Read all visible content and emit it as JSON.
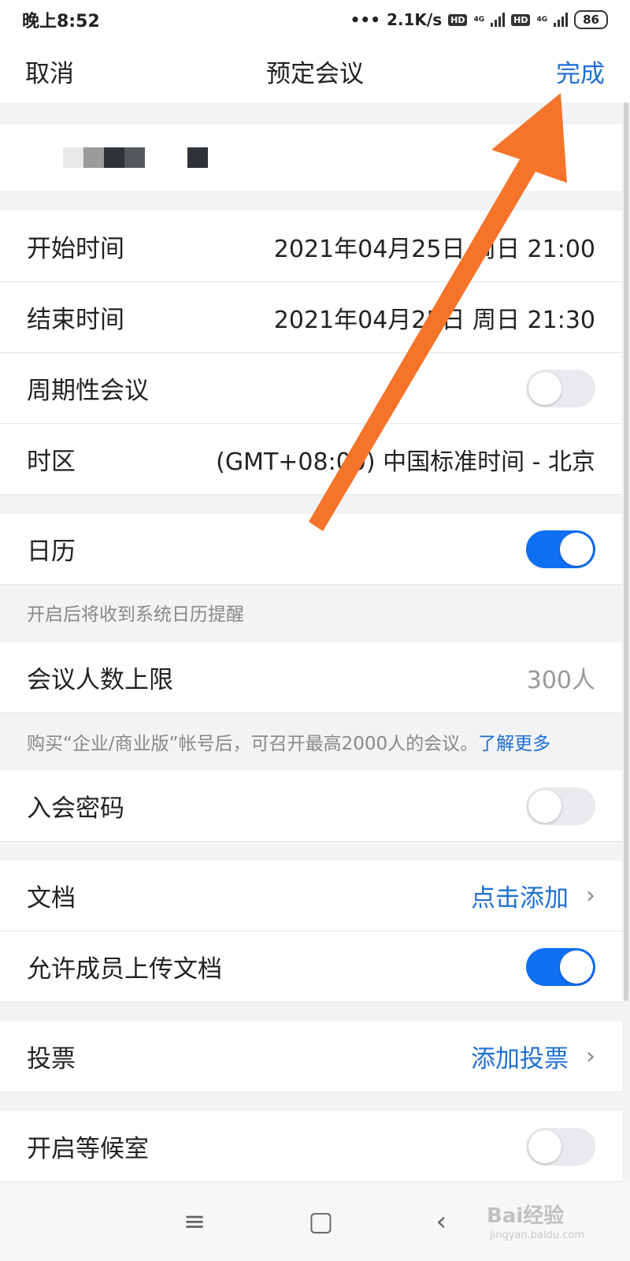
{
  "status_bar": {
    "time": "晚上8:52",
    "speed": "2.1K/s",
    "hd": "HD",
    "net": "4G",
    "battery": "86"
  },
  "nav": {
    "cancel": "取消",
    "title": "预定会议",
    "done": "完成"
  },
  "rows": {
    "start_time": {
      "label": "开始时间",
      "value": "2021年04月25日 周日 21:00"
    },
    "end_time": {
      "label": "结束时间",
      "value": "2021年04月25日 周日 21:30"
    },
    "recurring": {
      "label": "周期性会议",
      "on": false
    },
    "timezone": {
      "label": "时区",
      "value": "(GMT+08:00) 中国标准时间 - 北京"
    },
    "calendar": {
      "label": "日历",
      "on": true
    },
    "calendar_note": "开启后将收到系统日历提醒",
    "capacity": {
      "label": "会议人数上限",
      "value": "300人"
    },
    "capacity_note": "购买“企业/商业版”帐号后，可召开最高2000人的会议。",
    "capacity_more": "了解更多",
    "password": {
      "label": "入会密码",
      "on": false
    },
    "docs": {
      "label": "文档",
      "action": "点击添加"
    },
    "allow_upload": {
      "label": "允许成员上传文档",
      "on": true
    },
    "vote": {
      "label": "投票",
      "action": "添加投票"
    },
    "waiting_room": {
      "label": "开启等候室",
      "on": false
    }
  },
  "watermark": {
    "brand": "Bai经验",
    "url": "jingyan.baidu.com"
  },
  "colors": {
    "accent": "#1f6fd4",
    "toggle_on": "#0f6ff2",
    "arrow": "#f5742a"
  }
}
